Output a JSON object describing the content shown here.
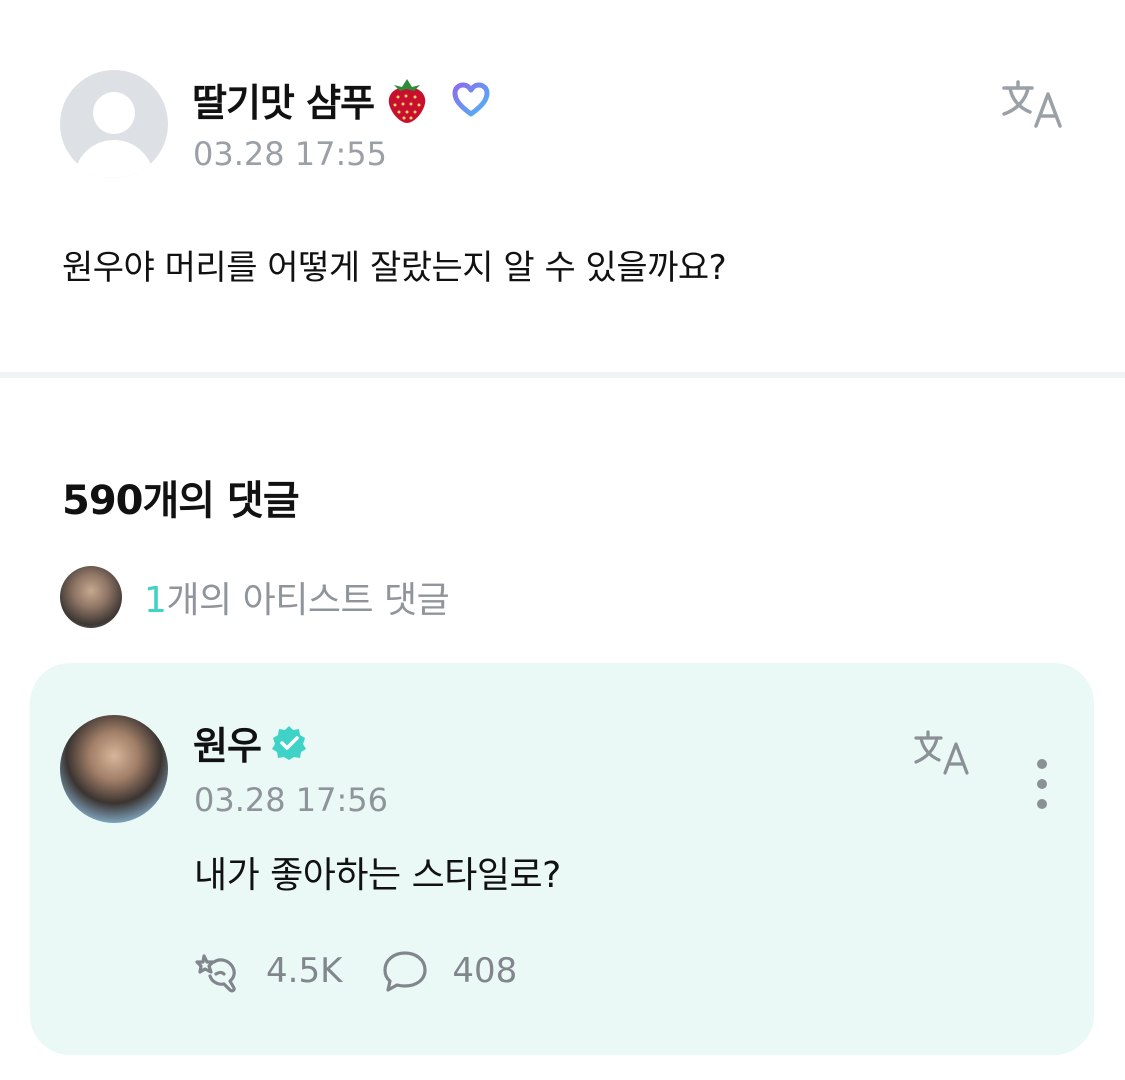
{
  "post": {
    "author_name": "딸기맛 샴푸",
    "timestamp": "03.28 17:55",
    "body": "원우야 머리를 어떻게 잘랐는지 알 수 있을까요?",
    "translate_icon": "translate-icon",
    "badge_icon": "heart-badge-icon"
  },
  "comments": {
    "count_label": "590개의 댓글",
    "artist_count_num": "1",
    "artist_count_label": "개의 아티스트 댓글"
  },
  "artist_comment": {
    "author_name": "원우",
    "timestamp": "03.28 17:56",
    "text": "내가 좋아하는 스타일로?",
    "likes": "4.5K",
    "replies": "408",
    "verified_icon": "verified-check-icon",
    "accent_color": "#3fd2c7",
    "card_color": "#eaf8f6"
  }
}
